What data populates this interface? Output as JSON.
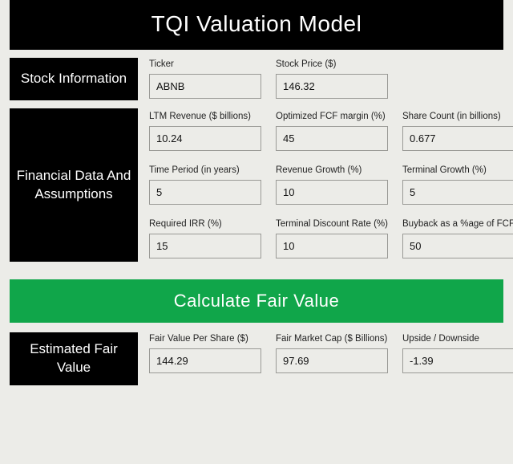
{
  "title": "TQI Valuation Model",
  "stock": {
    "heading": "Stock Information",
    "ticker_label": "Ticker",
    "ticker": "ABNB",
    "price_label": "Stock Price ($)",
    "price": "146.32"
  },
  "assumptions": {
    "heading": "Financial Data And Assumptions",
    "ltm_rev_label": "LTM Revenue ($ billions)",
    "ltm_rev": "10.24",
    "fcf_margin_label": "Optimized FCF margin (%)",
    "fcf_margin": "45",
    "share_count_label": "Share Count (in billions)",
    "share_count": "0.677",
    "time_period_label": "Time Period (in years)",
    "time_period": "5",
    "rev_growth_label": "Revenue Growth (%)",
    "rev_growth": "10",
    "terminal_growth_label": "Terminal Growth (%)",
    "terminal_growth": "5",
    "irr_label": "Required IRR (%)",
    "irr": "15",
    "terminal_disc_label": "Terminal Discount Rate (%)",
    "terminal_disc": "10",
    "buyback_label": "Buyback as a %age of FCF",
    "buyback": "50"
  },
  "calculate_label": "Calculate Fair Value",
  "results": {
    "heading": "Estimated Fair Value",
    "fv_share_label": "Fair Value Per Share ($)",
    "fv_share": "144.29",
    "fv_cap_label": "Fair Market Cap ($ Billions)",
    "fv_cap": "97.69",
    "upside_label": "Upside / Downside",
    "upside": "-1.39"
  }
}
